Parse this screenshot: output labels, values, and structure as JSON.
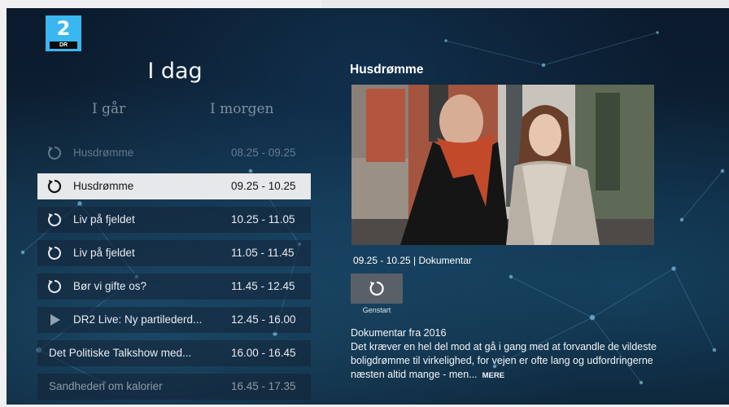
{
  "channel": {
    "logo_number": "2",
    "logo_text": "DR"
  },
  "schedule": {
    "current_day": "I dag",
    "prev_day": "I går",
    "next_day": "I morgen",
    "items": [
      {
        "title": "Husdrømme",
        "time": "08.25 - 09.25",
        "icon": "restart-icon"
      },
      {
        "title": "Husdrømme",
        "time": "09.25 - 10.25",
        "icon": "restart-icon"
      },
      {
        "title": "Liv på fjeldet",
        "time": "10.25 - 11.05",
        "icon": "restart-icon"
      },
      {
        "title": "Liv på fjeldet",
        "time": "11.05 - 11.45",
        "icon": "restart-icon"
      },
      {
        "title": "Bør vi gifte os?",
        "time": "11.45 - 12.45",
        "icon": "restart-icon"
      },
      {
        "title": "DR2 Live: Ny partilederd...",
        "time": "12.45 - 16.00",
        "icon": "play-icon"
      },
      {
        "title": "Det Politiske Talkshow med...",
        "time": "16.00 - 16.45",
        "icon": ""
      },
      {
        "title": "Sandheden om kalorier",
        "time": "16.45 - 17.35",
        "icon": ""
      }
    ]
  },
  "detail": {
    "title": "Husdrømme",
    "meta": "09.25 - 10.25 | Dokumentar",
    "restart_label": "Genstart",
    "description_heading": "Dokumentar fra 2016",
    "description": "Det kræver en hel del mod at gå i gang med at forvandle de vildeste boligdrømme til virkelighed, for vejen er ofte lang og udfordringerne næsten altid mange - men...",
    "more_label": "MERE"
  },
  "colors": {
    "background": "#0d2236",
    "selected_row": "#e7e8ea",
    "logo": "#3ab7f0"
  }
}
